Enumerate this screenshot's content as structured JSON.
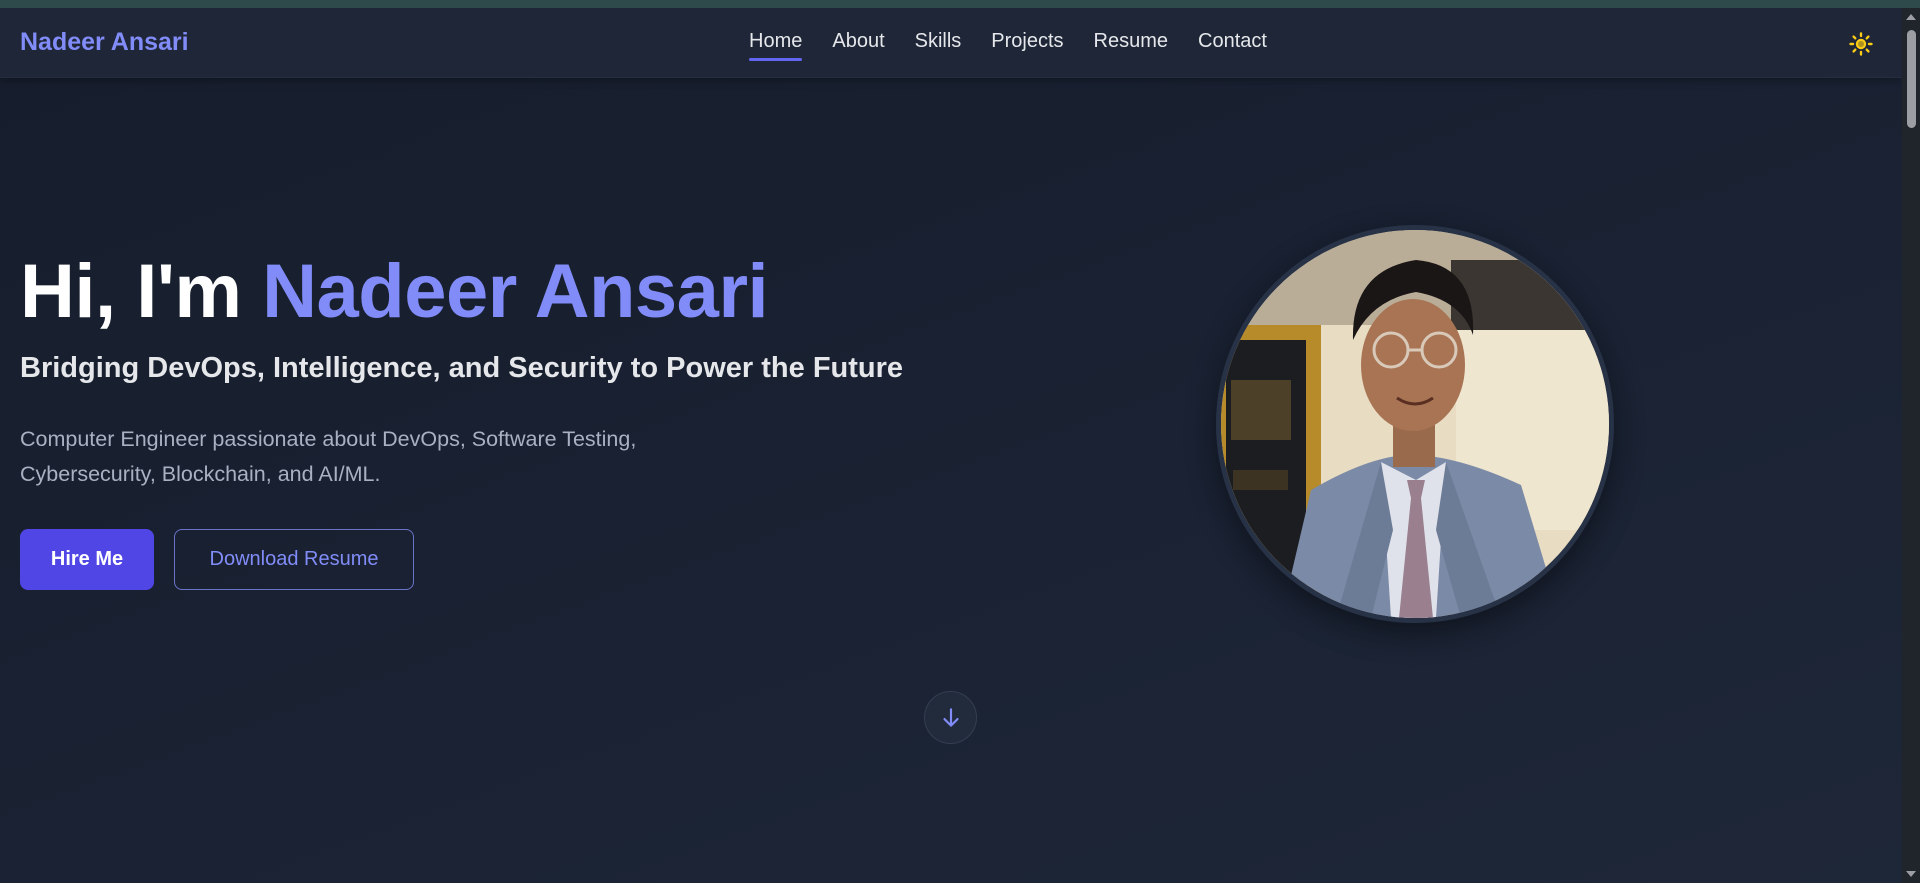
{
  "navbar": {
    "brand": "Nadeer Ansari",
    "links": [
      {
        "label": "Home",
        "active": true
      },
      {
        "label": "About"
      },
      {
        "label": "Skills"
      },
      {
        "label": "Projects"
      },
      {
        "label": "Resume"
      },
      {
        "label": "Contact"
      }
    ],
    "theme_toggle_icon": "sun-icon"
  },
  "hero": {
    "greeting": "Hi, I'm",
    "name": "Nadeer Ansari",
    "subtitle": "Bridging DevOps, Intelligence, and Security to Power the Future",
    "description": "Computer Engineer passionate about DevOps, Software Testing, Cybersecurity, Blockchain, and AI/ML.",
    "hire_button": "Hire Me",
    "resume_button": "Download Resume",
    "scroll_icon": "arrow-down-icon"
  },
  "colors": {
    "accent": "#818cf8",
    "primary_button": "#4f46e5",
    "background": "#1a2233",
    "sun": "#facc15"
  }
}
